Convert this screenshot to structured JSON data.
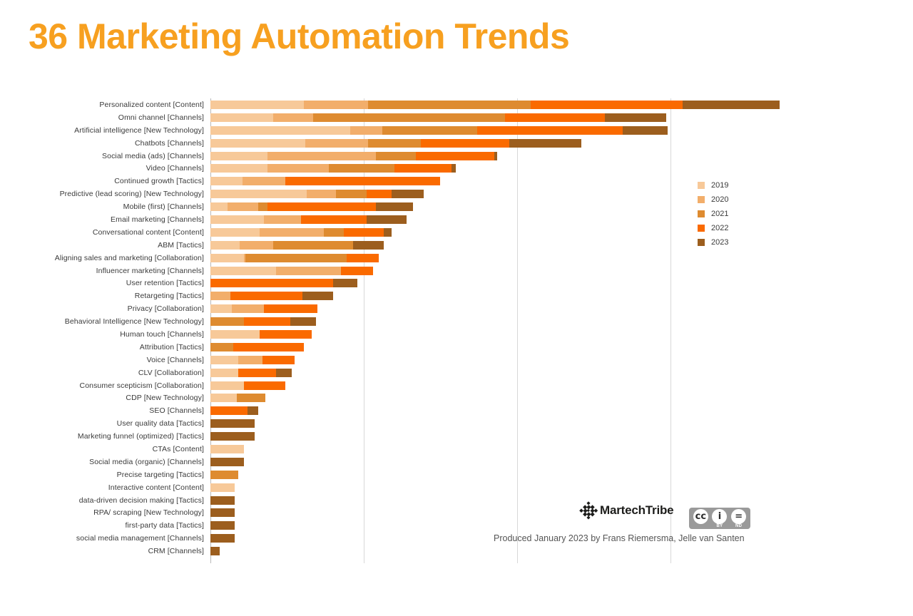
{
  "title": "36 Marketing Automation Trends",
  "brand": {
    "name": "MartechTribe",
    "logo_icon": "martechtribe-diamond-logo",
    "license_icon": "creative-commons-badge",
    "license_cc": "cc",
    "license_by": "BY",
    "license_nd": "ND",
    "license_by_symbol": "i",
    "license_nd_symbol": "=",
    "credit": "Produced January 2023 by Frans Riemersma, Jelle van Santen"
  },
  "legend": {
    "position": "right",
    "items": [
      {
        "label": "2019",
        "color": "#F7C999"
      },
      {
        "label": "2020",
        "color": "#F2AE6B"
      },
      {
        "label": "2021",
        "color": "#DE8B30"
      },
      {
        "label": "2022",
        "color": "#FA6A00"
      },
      {
        "label": "2023",
        "color": "#9C5E1E"
      }
    ]
  },
  "chart_data": {
    "type": "bar",
    "orientation": "horizontal",
    "stacked": true,
    "title": "36 Marketing Automation Trends",
    "xlabel": "",
    "ylabel": "",
    "grid": true,
    "xlim": [
      0,
      3.9
    ],
    "xticks": [
      0,
      1,
      2,
      3
    ],
    "series": [
      "2019",
      "2020",
      "2021",
      "2022",
      "2023"
    ],
    "colors": [
      "#F7C999",
      "#F2AE6B",
      "#DE8B30",
      "#FA6A00",
      "#9C5E1E"
    ],
    "categories": [
      "Personalized content  [Content]",
      "Omni channel  [Channels]",
      "Artificial intelligence  [New Technology]",
      "Chatbots  [Channels]",
      "Social media (ads)  [Channels]",
      "Video  [Channels]",
      "Continued growth  [Tactics]",
      "Predictive (lead scoring)  [New Technology]",
      "Mobile (first)  [Channels]",
      "Email marketing  [Channels]",
      "Conversational content  [Content]",
      "ABM  [Tactics]",
      "Aligning sales and marketing  [Collaboration]",
      "Influencer marketing  [Channels]",
      "User retention  [Tactics]",
      "Retargeting  [Tactics]",
      "Privacy  [Collaboration]",
      "Behavioral Intelligence  [New Technology]",
      "Human touch  [Channels]",
      "Attribution  [Tactics]",
      "Voice  [Channels]",
      "CLV  [Collaboration]",
      "Consumer scepticism  [Collaboration]",
      "CDP  [New Technology]",
      "SEO  [Channels]",
      "User quality data  [Tactics]",
      "Marketing funnel (optimized)  [Tactics]",
      "CTAs  [Content]",
      "Social media (organic)  [Channels]",
      "Precise targeting  [Tactics]",
      "Interactive content  [Content]",
      "data-driven decision making  [Tactics]",
      "RPA/ scraping  [New Technology]",
      "first-party data  [Tactics]",
      "social media management  [Channels]",
      "CRM  [Channels]"
    ],
    "rows": [
      {
        "category": "Personalized content  [Content]",
        "values": [
          0.61,
          0.42,
          1.06,
          0.99,
          0.63
        ],
        "total": 3.71
      },
      {
        "category": "Omni channel  [Channels]",
        "values": [
          0.41,
          0.26,
          1.25,
          0.65,
          0.4
        ],
        "total": 2.97
      },
      {
        "category": "Artificial intelligence  [New Technology]",
        "values": [
          0.91,
          0.21,
          0.62,
          0.95,
          0.29
        ],
        "total": 2.98
      },
      {
        "category": "Chatbots  [Channels]",
        "values": [
          0.62,
          0.41,
          0.34,
          0.58,
          0.47
        ],
        "total": 2.42
      },
      {
        "category": "Social media (ads)  [Channels]",
        "values": [
          0.37,
          0.71,
          0.26,
          0.51,
          0.02
        ],
        "total": 1.87
      },
      {
        "category": "Video  [Channels]",
        "values": [
          0.37,
          0.4,
          0.43,
          0.37,
          0.03
        ],
        "total": 1.6
      },
      {
        "category": "Continued growth  [Tactics]",
        "values": [
          0.21,
          0.28,
          0.0,
          1.01,
          0.0
        ],
        "total": 1.5
      },
      {
        "category": "Predictive (lead scoring)  [New Technology]",
        "values": [
          0.63,
          0.19,
          0.2,
          0.16,
          0.21
        ],
        "total": 1.39
      },
      {
        "category": "Mobile (first)  [Channels]",
        "values": [
          0.11,
          0.2,
          0.06,
          0.71,
          0.24
        ],
        "total": 1.32
      },
      {
        "category": "Email marketing  [Channels]",
        "values": [
          0.35,
          0.24,
          0.0,
          0.43,
          0.26
        ],
        "total": 1.28
      },
      {
        "category": "Conversational content  [Content]",
        "values": [
          0.32,
          0.42,
          0.13,
          0.26,
          0.05
        ],
        "total": 1.18
      },
      {
        "category": "ABM  [Tactics]",
        "values": [
          0.19,
          0.22,
          0.52,
          0.0,
          0.2
        ],
        "total": 1.13
      },
      {
        "category": "Aligning sales and marketing  [Collaboration]",
        "values": [
          0.22,
          0.01,
          0.66,
          0.21,
          0.0
        ],
        "total": 1.1
      },
      {
        "category": "Influencer marketing  [Channels]",
        "values": [
          0.43,
          0.42,
          0.0,
          0.21,
          0.0
        ],
        "total": 1.06
      },
      {
        "category": "User retention  [Tactics]",
        "values": [
          0.0,
          0.0,
          0.0,
          0.8,
          0.16
        ],
        "total": 0.96
      },
      {
        "category": "Retargeting  [Tactics]",
        "values": [
          0.0,
          0.13,
          0.0,
          0.47,
          0.2
        ],
        "total": 0.8
      },
      {
        "category": "Privacy  [Collaboration]",
        "values": [
          0.14,
          0.21,
          0.0,
          0.35,
          0.0
        ],
        "total": 0.7
      },
      {
        "category": "Behavioral Intelligence  [New Technology]",
        "values": [
          0.0,
          0.0,
          0.22,
          0.3,
          0.17
        ],
        "total": 0.69
      },
      {
        "category": "Human touch  [Channels]",
        "values": [
          0.32,
          0.0,
          0.0,
          0.34,
          0.0
        ],
        "total": 0.66
      },
      {
        "category": "Attribution  [Tactics]",
        "values": [
          0.0,
          0.0,
          0.15,
          0.46,
          0.0
        ],
        "total": 0.61
      },
      {
        "category": "Voice  [Channels]",
        "values": [
          0.18,
          0.16,
          0.0,
          0.21,
          0.0
        ],
        "total": 0.55
      },
      {
        "category": "CLV  [Collaboration]",
        "values": [
          0.18,
          0.0,
          0.0,
          0.25,
          0.1
        ],
        "total": 0.53
      },
      {
        "category": "Consumer scepticism  [Collaboration]",
        "values": [
          0.22,
          0.0,
          0.0,
          0.27,
          0.0
        ],
        "total": 0.49
      },
      {
        "category": "CDP  [New Technology]",
        "values": [
          0.17,
          0.0,
          0.19,
          0.0,
          0.0
        ],
        "total": 0.36
      },
      {
        "category": "SEO  [Channels]",
        "values": [
          0.0,
          0.0,
          0.0,
          0.24,
          0.07
        ],
        "total": 0.31
      },
      {
        "category": "User quality data  [Tactics]",
        "values": [
          0.0,
          0.0,
          0.0,
          0.0,
          0.29
        ],
        "total": 0.29
      },
      {
        "category": "Marketing funnel (optimized)  [Tactics]",
        "values": [
          0.0,
          0.0,
          0.0,
          0.0,
          0.29
        ],
        "total": 0.29
      },
      {
        "category": "CTAs  [Content]",
        "values": [
          0.22,
          0.0,
          0.0,
          0.0,
          0.0
        ],
        "total": 0.22
      },
      {
        "category": "Social media (organic)  [Channels]",
        "values": [
          0.0,
          0.0,
          0.0,
          0.0,
          0.22
        ],
        "total": 0.22
      },
      {
        "category": "Precise targeting  [Tactics]",
        "values": [
          0.0,
          0.0,
          0.18,
          0.0,
          0.0
        ],
        "total": 0.18
      },
      {
        "category": "Interactive content  [Content]",
        "values": [
          0.16,
          0.0,
          0.0,
          0.0,
          0.0
        ],
        "total": 0.16
      },
      {
        "category": "data-driven decision making  [Tactics]",
        "values": [
          0.0,
          0.0,
          0.0,
          0.0,
          0.16
        ],
        "total": 0.16
      },
      {
        "category": "RPA/ scraping  [New Technology]",
        "values": [
          0.0,
          0.0,
          0.0,
          0.0,
          0.16
        ],
        "total": 0.16
      },
      {
        "category": "first-party data  [Tactics]",
        "values": [
          0.0,
          0.0,
          0.0,
          0.0,
          0.16
        ],
        "total": 0.16
      },
      {
        "category": "social media management  [Channels]",
        "values": [
          0.0,
          0.0,
          0.0,
          0.0,
          0.16
        ],
        "total": 0.16
      },
      {
        "category": "CRM  [Channels]",
        "values": [
          0.0,
          0.0,
          0.0,
          0.0,
          0.06
        ],
        "total": 0.06
      }
    ]
  }
}
